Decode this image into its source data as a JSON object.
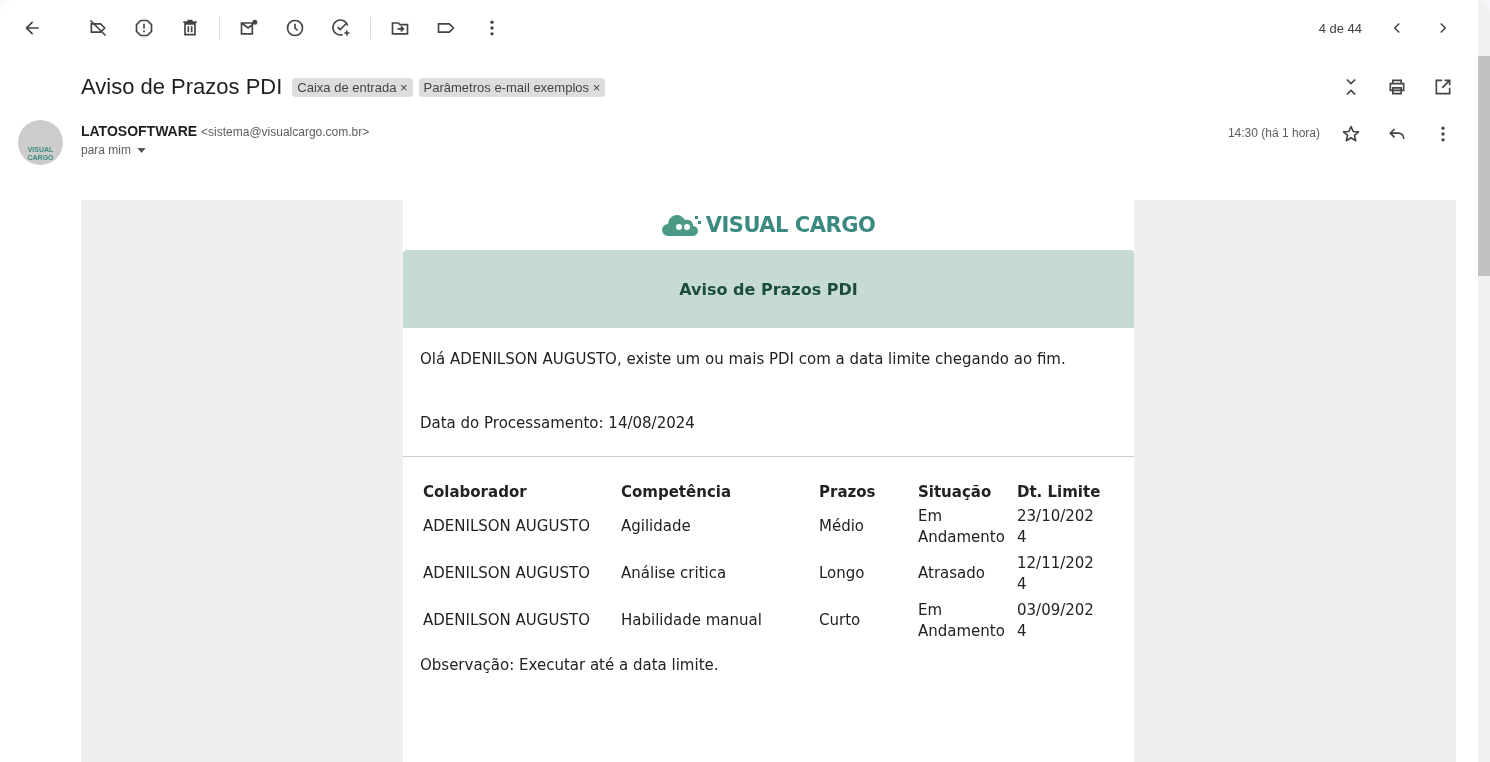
{
  "toolbar": {
    "pager": "4 de 44"
  },
  "subject": "Aviso de Prazos PDI",
  "labels": [
    {
      "text": "Caixa de entrada",
      "remove": "×"
    },
    {
      "text": "Parâmetros e-mail exemplos",
      "remove": "×"
    }
  ],
  "sender": {
    "avatar_text": "VISUAL CARGO",
    "name": "LATOSOFTWARE",
    "email": "<sistema@visualcargo.com.br>",
    "recipient": "para mim",
    "time": "14:30 (há 1 hora)",
    "starred": false
  },
  "email": {
    "logo_text": "VISUAL CARGO",
    "heading": "Aviso de Prazos PDI",
    "greeting": "Olá ADENILSON AUGUSTO, existe um ou mais PDI com a data limite chegando ao fim.",
    "processing_date": "Data do Processamento: 14/08/2024",
    "table": {
      "columns": [
        "Colaborador",
        "Competência",
        "Prazos",
        "Situação",
        "Dt. Limite"
      ],
      "rows": [
        [
          "ADENILSON AUGUSTO",
          "Agilidade",
          "Médio",
          "Em Andamento",
          "23/10/2024"
        ],
        [
          "ADENILSON AUGUSTO",
          "Análise critica",
          "Longo",
          "Atrasado",
          "12/11/2024"
        ],
        [
          "ADENILSON AUGUSTO",
          "Habilidade manual",
          "Curto",
          "Em Andamento",
          "03/09/2024"
        ]
      ]
    },
    "note": "Observação: Executar até a data limite."
  }
}
